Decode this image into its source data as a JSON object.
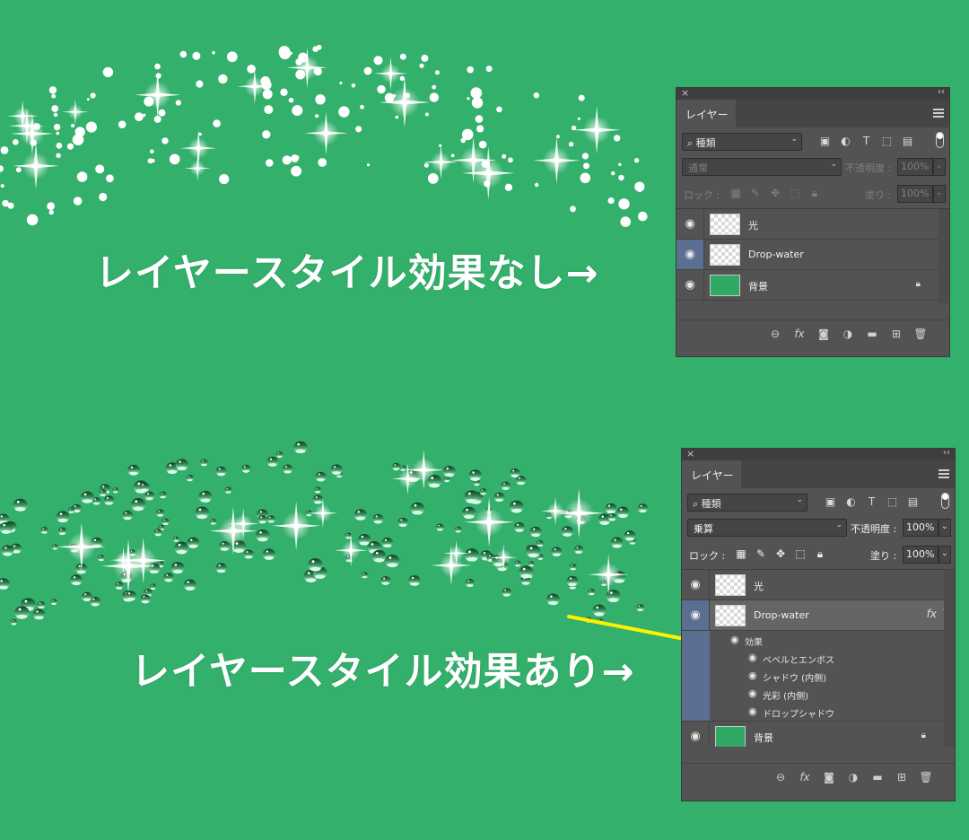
{
  "captions": {
    "top": "レイヤースタイル効果なし→",
    "bottom": "レイヤースタイル効果あり→"
  },
  "colors": {
    "background": "#33b06b",
    "highlight": "#fff200",
    "panel_bg": "#535353",
    "selected_eye": "#5a6f92"
  },
  "panel_top": {
    "tab": "レイヤー",
    "filter_kind": "種類",
    "blend_mode": "通常",
    "opacity_label": "不透明度 :",
    "opacity_value": "100%",
    "lock_label": "ロック :",
    "fill_label": "塗り :",
    "fill_value": "100%",
    "layers": [
      {
        "name": "光",
        "thumb": "transparent",
        "selected": false
      },
      {
        "name": "Drop-water",
        "thumb": "transparent",
        "selected": true
      },
      {
        "name": "背景",
        "thumb": "green",
        "locked": true
      }
    ]
  },
  "panel_bottom": {
    "tab": "レイヤー",
    "filter_kind": "種類",
    "blend_mode": "乗算",
    "opacity_label": "不透明度 :",
    "opacity_value": "100%",
    "lock_label": "ロック :",
    "fill_label": "塗り :",
    "fill_value": "100%",
    "layers": [
      {
        "name": "光",
        "thumb": "transparent"
      },
      {
        "name": "Drop-water",
        "thumb": "transparent",
        "selected": true,
        "fx": "fx"
      },
      {
        "name": "背景",
        "thumb": "green",
        "locked": true
      }
    ],
    "effects_group": "効果",
    "effects": [
      "ベベルとエンボス",
      "シャドウ (内側)",
      "光彩 (内側)",
      "ドロップシャドウ"
    ]
  },
  "icon_names": {
    "filter_icons": [
      "image-filter-icon",
      "adjustment-filter-icon",
      "type-filter-icon",
      "shape-filter-icon",
      "smart-object-filter-icon"
    ],
    "lock_icons": [
      "lock-transparent-icon",
      "lock-paint-icon",
      "lock-position-icon",
      "lock-artboard-icon",
      "lock-all-icon"
    ],
    "bottom_icons": [
      "link-layers-icon",
      "add-style-icon",
      "add-mask-icon",
      "new-adjustment-icon",
      "new-group-icon",
      "new-layer-icon",
      "delete-layer-icon"
    ]
  }
}
